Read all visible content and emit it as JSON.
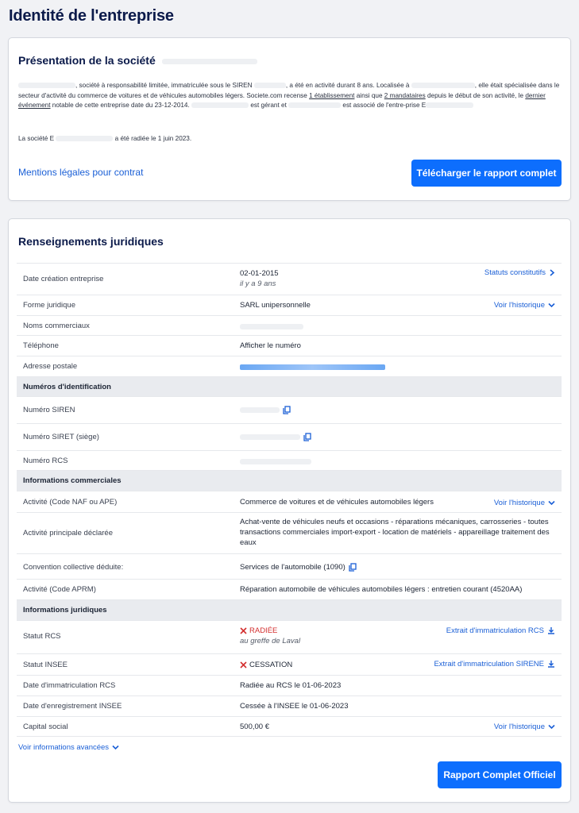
{
  "page": {
    "title": "Identité de l'entreprise"
  },
  "presentation": {
    "title": "Présentation de la société",
    "desc_1": ", société à responsabilité limitée, immatriculée sous le SIREN",
    "desc_2": ", a été en activité durant 8 ans. Localisée à",
    "desc_3": ", elle était spécialisée dans le secteur d'activité du commerce de voitures et de véhicules automobiles légers. Societe.com recense",
    "link_etab": "1 établissement",
    "desc_4": " ainsi que",
    "link_mand": "2 mandataires",
    "desc_5": " depuis le début de son activité, le",
    "link_event": "dernier événement",
    "desc_6": " notable de cette entreprise date du 23-12-2014.",
    "desc_7": "est gérant et",
    "desc_8": "est associé de l'entre-prise E",
    "radiated_1": "La société E",
    "radiated_2": "a été radiée le 1 juin 2023.",
    "legal_link": "Mentions légales pour contrat",
    "report_button": "Télécharger le rapport complet"
  },
  "juridique": {
    "title": "Renseignements juridiques",
    "rows": {
      "creation_label": "Date création entreprise",
      "creation_value": "02-01-2015",
      "creation_sub": "il y a 9 ans",
      "creation_action": "Statuts constitutifs",
      "forme_label": "Forme juridique",
      "forme_value": "SARL unipersonnelle",
      "forme_action": "Voir l'historique",
      "noms_label": "Noms commerciaux",
      "tel_label": "Téléphone",
      "tel_value": "Afficher le numéro",
      "adresse_label": "Adresse postale",
      "sec_id": "Numéros d'identification",
      "siren_label": "Numéro SIREN",
      "siret_label": "Numéro SIRET (siège)",
      "rcs_label": "Numéro RCS",
      "sec_com": "Informations commerciales",
      "naf_label": "Activité (Code NAF ou APE)",
      "naf_value": "Commerce de voitures et de véhicules automobiles légers",
      "naf_action": "Voir l'historique",
      "principale_label": "Activité principale déclarée",
      "principale_value": "Achat-vente de véhicules neufs et occasions - réparations mécaniques, carrosseries - toutes transactions commerciales import-export - location de matériels - appareillage traitement des eaux",
      "convention_label": "Convention collective déduite:",
      "convention_value": "Services de l'automobile (1090)",
      "aprm_label": "Activité (Code APRM)",
      "aprm_value": "Réparation automobile de véhicules automobiles légers : entretien courant (4520AA)",
      "sec_jur": "Informations juridiques",
      "statut_rcs_label": "Statut RCS",
      "statut_rcs_value": "RADIÉE",
      "statut_rcs_sub": "au greffe de Laval",
      "statut_rcs_action": "Extrait d'immatriculation RCS",
      "statut_insee_label": "Statut INSEE",
      "statut_insee_value": "CESSATION",
      "statut_insee_action": "Extrait d'immatriculation SIRENE",
      "immat_label": "Date d'immatriculation RCS",
      "immat_value": "Radiée au RCS le 01-06-2023",
      "enreg_label": "Date d'enregistrement INSEE",
      "enreg_value": "Cessée à l'INSEE le 01-06-2023",
      "capital_label": "Capital social",
      "capital_value": "500,00 €",
      "capital_action": "Voir l'historique"
    },
    "more_link": "Voir informations avancées",
    "official_button": "Rapport Complet Officiel"
  },
  "colors": {
    "accent": "#0d6efd",
    "link": "#1a5fd6",
    "danger": "#d32f2f",
    "title": "#0b1a4a"
  }
}
